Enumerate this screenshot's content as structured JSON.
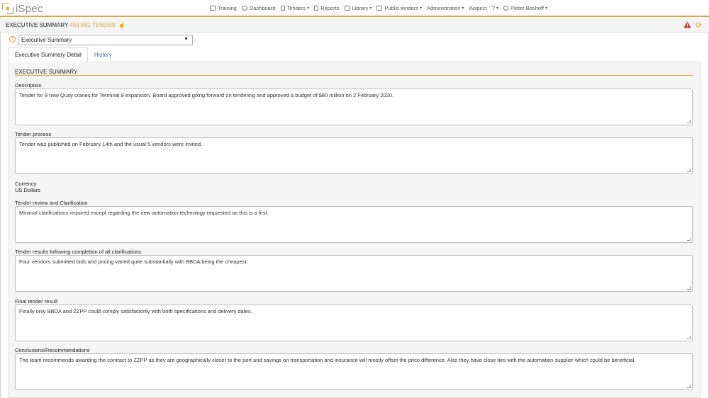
{
  "app": {
    "name": "iSpec"
  },
  "nav": {
    "items": [
      {
        "label": "Training",
        "icon": "training-icon",
        "has_caret": false
      },
      {
        "label": "Dashboard",
        "icon": "dashboard-icon",
        "has_caret": false
      },
      {
        "label": "Tenders",
        "icon": "tenders-icon",
        "has_caret": true
      },
      {
        "label": "Reports",
        "icon": "reports-icon",
        "has_caret": false
      },
      {
        "label": "Library",
        "icon": "library-icon",
        "has_caret": true
      },
      {
        "label": "Public tenders",
        "icon": "public-tenders-icon",
        "has_caret": true
      },
      {
        "label": "Administration",
        "icon": "",
        "has_caret": true
      },
      {
        "label": "iNspect",
        "icon": "",
        "has_caret": false
      }
    ],
    "help_caret": "▾",
    "user": "Pieter Boshoff"
  },
  "header": {
    "title": "EXECUTIVE SUMMARY",
    "number": "453 BIG TENDER",
    "accent": "#e3a53c",
    "warning_color": "#c9302c"
  },
  "selector": {
    "value": "Executive Summary",
    "help": "?"
  },
  "tabs": [
    {
      "label": "Executive Summary Detail",
      "active": true
    },
    {
      "label": "History",
      "active": false
    }
  ],
  "section": {
    "title": "EXECUTIVE SUMMARY"
  },
  "fields": {
    "description": {
      "label": "Description",
      "value": "Tender for 8 new Quay cranes for Terminal 8 expansion. Board approved going forward on tendering and approved a budget of $80 million on 2 February 2020."
    },
    "tender_process": {
      "label": "Tender process",
      "value": "Tender was published on February 14th and the usual 5 vendors were invited."
    },
    "currency": {
      "label": "Currency",
      "value": "US Dollars"
    },
    "review": {
      "label": "Tender review and Clarification",
      "value": "Minimal clarifications required except regarding the new automation technology requested as this is a first."
    },
    "results": {
      "label": "Tender results following completion of all clarifications",
      "value": "Four vendors submitted bids and pricing varied quite substantially with BBDA being the cheapest."
    },
    "final": {
      "label": "Final tender result",
      "value": "Finally only BBDA and ZZPP could comply satisfactorily with both specifications and delivery dates."
    },
    "conclusions": {
      "label": "Conclusions/Recommendations",
      "value": "The team recommends awarding the contract to ZZPP as they are geographically closer to the port and savings on transportation and insurance will mostly offset the price difference. Also they have close ties with the automation supplier which could be beneficial."
    }
  }
}
